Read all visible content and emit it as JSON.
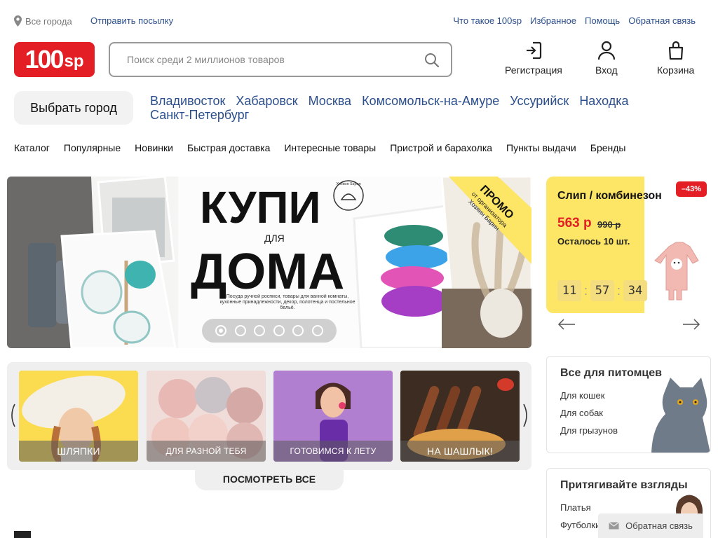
{
  "topbar": {
    "city": "Все города",
    "send_parcel": "Отправить посылку",
    "links": [
      "Что такое 100sp",
      "Избранное",
      "Помощь",
      "Обратная связь"
    ]
  },
  "logo": {
    "main": "100",
    "suffix": "sp",
    "color": "#e31e24"
  },
  "search": {
    "placeholder": "Поиск среди 2 миллионов товаров",
    "value": ""
  },
  "header_buttons": {
    "register": "Регистрация",
    "login": "Вход",
    "cart": "Корзина"
  },
  "city_select": {
    "button": "Выбрать город",
    "cities": [
      "Владивосток",
      "Хабаровск",
      "Москва",
      "Комсомольск-на-Амуре",
      "Уссурийск",
      "Находка",
      "Санкт-Петербург"
    ]
  },
  "nav": [
    "Каталог",
    "Популярные",
    "Новинки",
    "Быстрая доставка",
    "Интересные товары",
    "Пристрой и барахолка",
    "Пункты выдачи",
    "Бренды"
  ],
  "banner": {
    "title_line1": "КУПИ",
    "title_small": "ДЛЯ",
    "title_line2": "ДОМА",
    "description": "Посуда ручной росписи, товары для ванной комнаты, кухонные принадлежности, декор, полотенца и постельное бельё.",
    "promo_label": "ПРОМО",
    "promo_sub1": "от организатора",
    "promo_sub2": "Хозяин Барин",
    "brand": "Хозяин Барин",
    "slides_total": 6,
    "active_slide": 1
  },
  "deal": {
    "title": "Слип / комбинезон",
    "discount": "–43%",
    "price": "563 р",
    "old_price": "990 р",
    "remaining": "Осталось 10 шт.",
    "timer": [
      "11",
      "57",
      "34"
    ]
  },
  "categories": [
    {
      "label": "ШЛЯПКИ"
    },
    {
      "label": "ДЛЯ РАЗНОЙ ТЕБЯ"
    },
    {
      "label": "ГОТОВИМСЯ К ЛЕТУ"
    },
    {
      "label": "НА ШАШЛЫК!"
    }
  ],
  "view_all": "ПОСМОТРЕТЬ ВСЕ",
  "pets": {
    "title": "Все для питомцев",
    "items": [
      "Для кошек",
      "Для собак",
      "Для грызунов"
    ]
  },
  "attract": {
    "title": "Притягивайте взгляды",
    "items": [
      "Платья",
      "Футболки"
    ]
  },
  "feedback": "Обратная связь"
}
